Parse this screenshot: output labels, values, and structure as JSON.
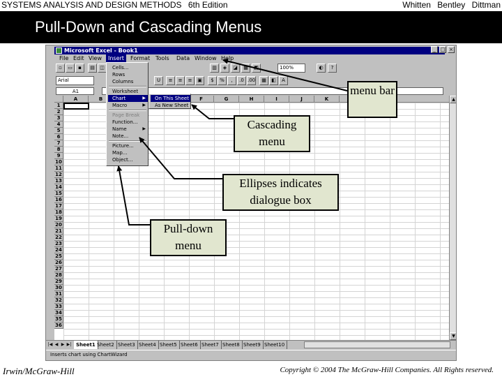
{
  "slide": {
    "header_left": "SYSTEMS ANALYSIS AND DESIGN METHODS",
    "header_edition": "6th Edition",
    "authors": [
      "Whitten",
      "Bentley",
      "Dittman"
    ],
    "title": "Pull-Down and Cascading Menus",
    "footer_left": "Irwin/McGraw-Hill",
    "footer_right": "Copyright © 2004 The McGraw-Hill Companies. All Rights reserved."
  },
  "excel": {
    "window_title": "Microsoft Excel - Book1",
    "menubar": [
      "File",
      "Edit",
      "View",
      "Insert",
      "Format",
      "Tools",
      "Data",
      "Window",
      "Help"
    ],
    "active_menu": "Insert",
    "zoom": "100%",
    "font_name": "Arial",
    "cell_reference": "A1",
    "columns": [
      "A",
      "B",
      "C",
      "D",
      "E",
      "F",
      "G",
      "H",
      "I",
      "J",
      "K"
    ],
    "rows": [
      "1",
      "2",
      "3",
      "4",
      "5",
      "6",
      "7",
      "8",
      "9",
      "10",
      "11",
      "12",
      "13",
      "14",
      "15",
      "16",
      "17",
      "18",
      "19",
      "20",
      "21",
      "22",
      "23",
      "24",
      "25",
      "26",
      "27",
      "28",
      "29",
      "30",
      "31",
      "32",
      "33",
      "34",
      "35",
      "36"
    ],
    "insert_menu": [
      {
        "label": "Cells...",
        "state": "normal"
      },
      {
        "label": "Rows",
        "state": "normal"
      },
      {
        "label": "Columns",
        "state": "normal"
      },
      {
        "label": "Worksheet",
        "state": "normal"
      },
      {
        "label": "Chart",
        "state": "selected",
        "submenu": true
      },
      {
        "label": "Macro",
        "state": "normal",
        "submenu": true
      },
      {
        "label": "Page Break",
        "state": "disabled"
      },
      {
        "label": "Function...",
        "state": "normal"
      },
      {
        "label": "Name",
        "state": "normal",
        "submenu": true
      },
      {
        "label": "Note...",
        "state": "normal"
      },
      {
        "label": "Picture...",
        "state": "normal"
      },
      {
        "label": "Map...",
        "state": "normal"
      },
      {
        "label": "Object...",
        "state": "normal"
      }
    ],
    "chart_submenu": [
      {
        "label": "On This Sheet",
        "state": "selected"
      },
      {
        "label": "As New Sheet",
        "state": "normal"
      }
    ],
    "sheet_tabs": [
      "Sheet1",
      "Sheet2",
      "Sheet3",
      "Sheet4",
      "Sheet5",
      "Sheet6",
      "Sheet7",
      "Sheet8",
      "Sheet9",
      "Sheet10"
    ],
    "active_sheet": "Sheet1",
    "status_text": "Inserts chart using ChartWizard"
  },
  "callouts": {
    "menu_bar": "menu bar",
    "cascading": "Cascading menu",
    "ellipses": "Ellipses indicates dialogue box",
    "pulldown": "Pull-down menu"
  },
  "colors": {
    "title_bar_bg": "#000000",
    "window_title_bg": "#000080",
    "selection": "#000080",
    "callout_bg": "#e1e6cf",
    "window_chrome": "#c0c0c0"
  }
}
